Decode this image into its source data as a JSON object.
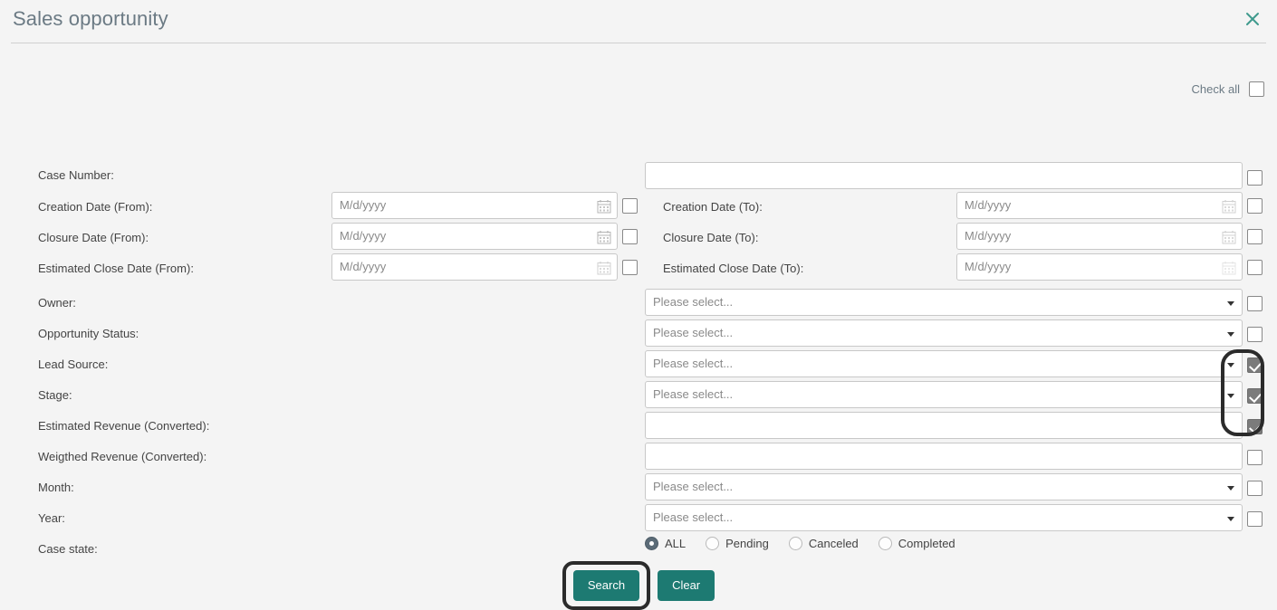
{
  "dialog": {
    "title": "Sales opportunity",
    "close_icon": "close-icon"
  },
  "check_all": {
    "label": "Check all",
    "checked": false
  },
  "placeholders": {
    "date": "M/d/yyyy",
    "select": "Please select...",
    "empty": ""
  },
  "fields": [
    {
      "label": "Case Number:",
      "type": "text",
      "value": "",
      "col": "right",
      "checked": false
    },
    {
      "label": "Creation Date (From):",
      "type": "date",
      "value": "M/d/yyyy",
      "col": "left",
      "checked": false
    },
    {
      "label": "Creation Date (To):",
      "type": "date",
      "value": "M/d/yyyy",
      "col": "right",
      "checked": false
    },
    {
      "label": "Closure Date (From):",
      "type": "date",
      "value": "M/d/yyyy",
      "col": "left",
      "checked": false
    },
    {
      "label": "Closure Date (To):",
      "type": "date",
      "value": "M/d/yyyy",
      "col": "right",
      "checked": false
    },
    {
      "label": "Estimated Close Date (From):",
      "type": "date",
      "value": "M/d/yyyy",
      "col": "left",
      "checked": false
    },
    {
      "label": "Estimated Close Date (To):",
      "type": "date",
      "value": "M/d/yyyy",
      "col": "right",
      "checked": false
    },
    {
      "label": "Owner:",
      "type": "select",
      "value": "Please select...",
      "col": "right",
      "checked": false
    },
    {
      "label": "Opportunity Status:",
      "type": "select",
      "value": "Please select...",
      "col": "right",
      "checked": false
    },
    {
      "label": "Lead Source:",
      "type": "select",
      "value": "Please select...",
      "col": "right",
      "checked": true
    },
    {
      "label": "Stage:",
      "type": "select",
      "value": "Please select...",
      "col": "right",
      "checked": true
    },
    {
      "label": "Estimated Revenue (Converted):",
      "type": "text",
      "value": "",
      "col": "right",
      "checked": true
    },
    {
      "label": "Weigthed Revenue (Converted):",
      "type": "text",
      "value": "",
      "col": "right",
      "checked": false
    },
    {
      "label": "Month:",
      "type": "select",
      "value": "Please select...",
      "col": "right",
      "checked": false
    },
    {
      "label": "Year:",
      "type": "select",
      "value": "Please select...",
      "col": "right",
      "checked": false
    },
    {
      "label": "Case state:",
      "type": "radio",
      "col": "right",
      "checked": false
    }
  ],
  "labels": {
    "case_number": "Case Number:",
    "creation_from": "Creation Date (From):",
    "creation_to": "Creation Date (To):",
    "closure_from": "Closure Date (From):",
    "closure_to": "Closure Date (To):",
    "est_close_from": "Estimated Close Date (From):",
    "est_close_to": "Estimated Close Date (To):",
    "owner": "Owner:",
    "opportunity_status": "Opportunity Status:",
    "lead_source": "Lead Source:",
    "stage": "Stage:",
    "estimated_revenue": "Estimated Revenue (Converted):",
    "weigthed_revenue": "Weigthed Revenue (Converted):",
    "month": "Month:",
    "year": "Year:",
    "case_state": "Case state:"
  },
  "values": {
    "case_number": "",
    "creation_from": "M/d/yyyy",
    "creation_to": "M/d/yyyy",
    "closure_from": "M/d/yyyy",
    "closure_to": "M/d/yyyy",
    "est_close_from": "M/d/yyyy",
    "est_close_to": "M/d/yyyy",
    "owner": "Please select...",
    "opportunity_status": "Please select...",
    "lead_source": "Please select...",
    "stage": "Please select...",
    "estimated_revenue": "",
    "weigthed_revenue": "",
    "month": "Please select...",
    "year": "Please select..."
  },
  "case_state": {
    "options": [
      {
        "label": "ALL",
        "selected": true
      },
      {
        "label": "Pending",
        "selected": false
      },
      {
        "label": "Canceled",
        "selected": false
      },
      {
        "label": "Completed",
        "selected": false
      }
    ]
  },
  "buttons": {
    "search": "Search",
    "clear": "Clear"
  },
  "colors": {
    "accent_teal": "#1d7a72",
    "title_gray": "#6b7a84",
    "page_bg": "#f4f4f4",
    "checkbox_checked": "#7b7b7b",
    "radio_selected": "#5b6b77",
    "focus_ring": "#2b2b2b"
  }
}
